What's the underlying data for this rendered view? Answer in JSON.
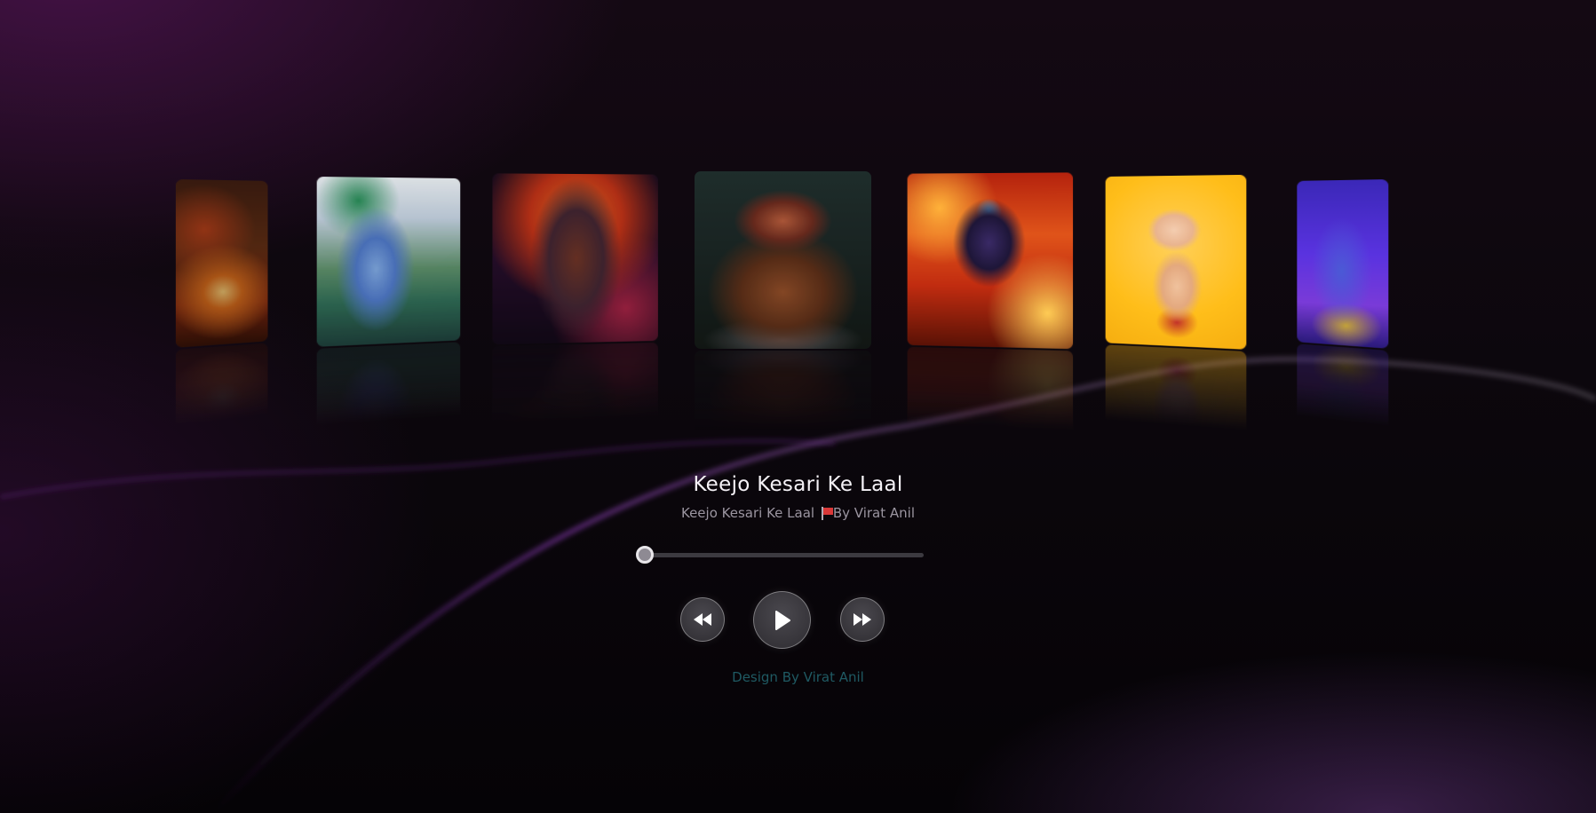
{
  "player": {
    "title": "Keejo Kesari Ke Laal",
    "subtitle_track": "Keejo Kesari Ke Laal",
    "subtitle_artist": "By Virat Anil",
    "flag_icon": "red-flag-icon",
    "progress": 0.0,
    "controls": {
      "prev_icon": "backward-icon",
      "play_icon": "play-icon",
      "next_icon": "forward-icon"
    }
  },
  "carousel": {
    "active_index": 3,
    "cards": [
      {
        "name": "card-temple-shrine"
      },
      {
        "name": "card-krishna-flute"
      },
      {
        "name": "card-ram-bow"
      },
      {
        "name": "card-hanuman-meditating"
      },
      {
        "name": "card-shiva-fire"
      },
      {
        "name": "card-bal-ganesha"
      },
      {
        "name": "card-blue-deity"
      }
    ]
  },
  "footer": {
    "credit": "Design By Virat Anil"
  },
  "colors": {
    "background": "#0a0609",
    "accent_wave": "#7a2fa8",
    "credit_text": "#1f5a63"
  }
}
